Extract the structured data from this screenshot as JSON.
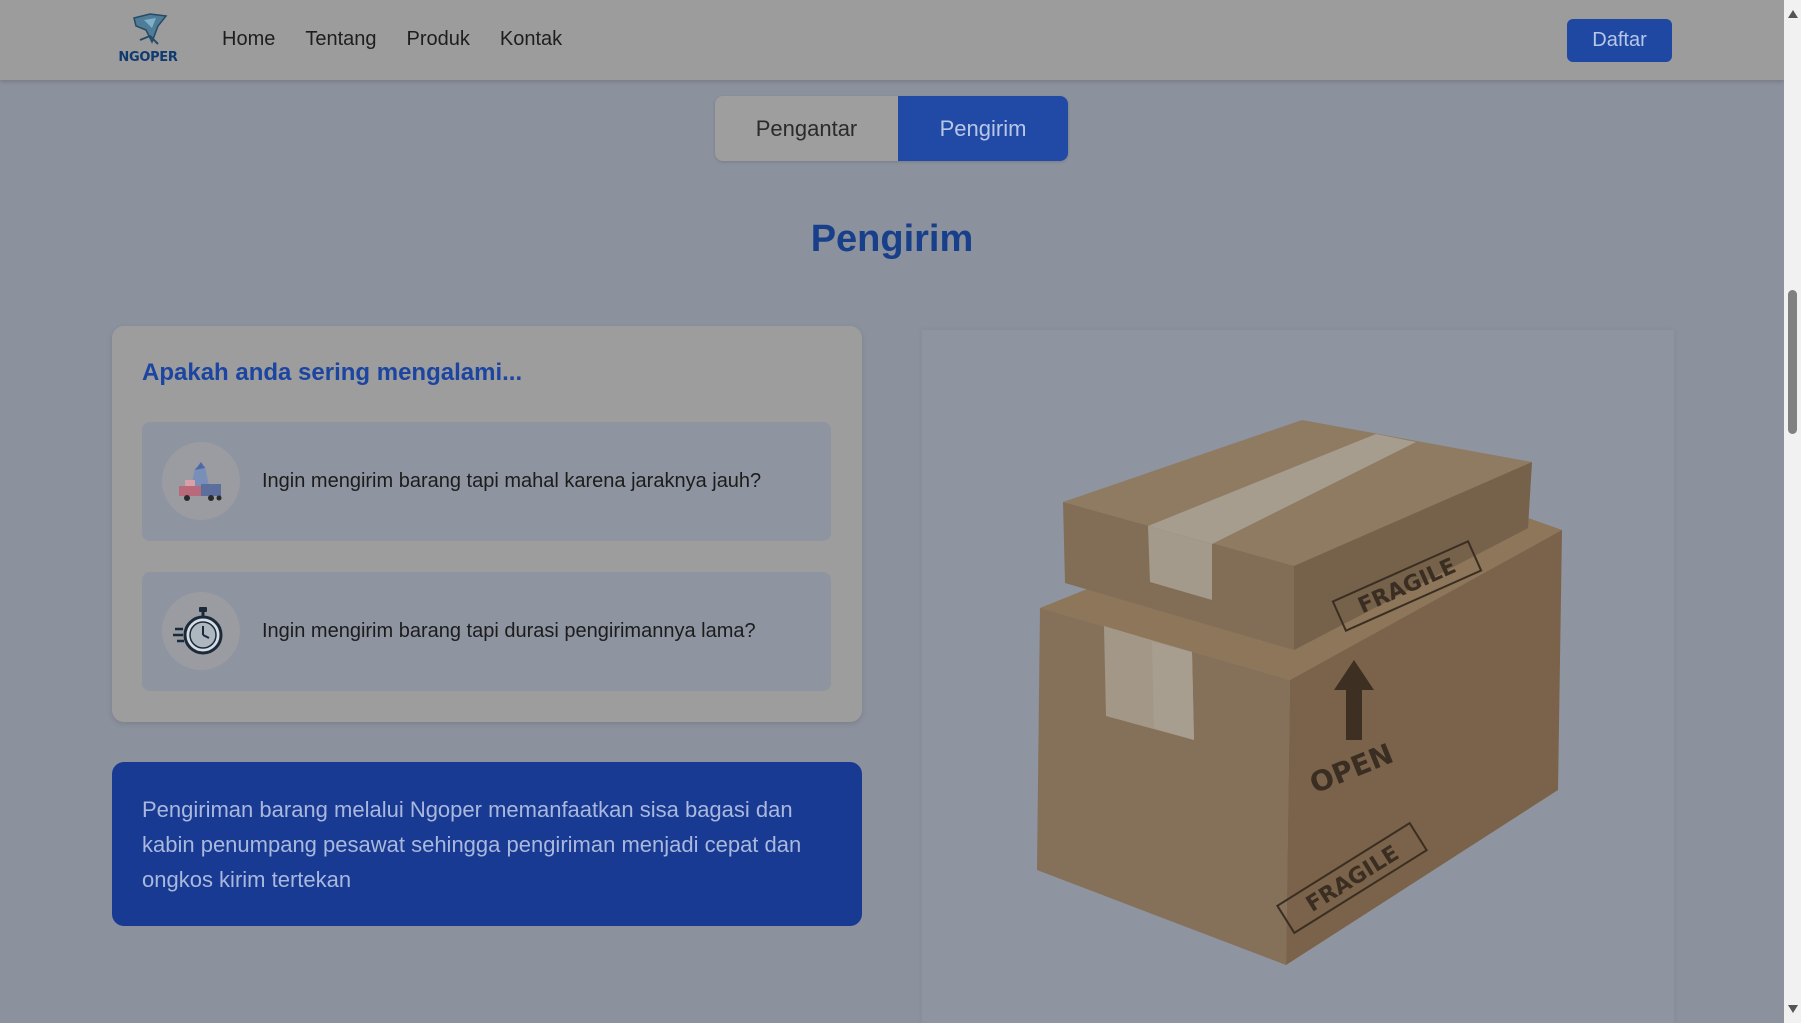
{
  "navbar": {
    "logo_text": "NGOPER",
    "links": [
      "Home",
      "Tentang",
      "Produk",
      "Kontak"
    ],
    "register_label": "Daftar"
  },
  "tabs": [
    {
      "label": "Pengantar",
      "active": false
    },
    {
      "label": "Pengirim",
      "active": true
    }
  ],
  "section": {
    "title": "Pengirim"
  },
  "problems": {
    "heading": "Apakah anda sering mengalami...",
    "items": [
      {
        "icon": "cargo-transport-icon",
        "text": "Ingin mengirim barang tapi mahal karena jaraknya jauh?"
      },
      {
        "icon": "stopwatch-icon",
        "text": "Ingin mengirim barang tapi durasi pengirimannya lama?"
      }
    ]
  },
  "info": {
    "text": "Pengiriman barang melalui Ngoper memanfaatkan sisa bagasi dan kabin penumpang pesawat sehingga pengiriman menjadi cepat dan ongkos kirim tertekan"
  },
  "illustration": {
    "label_top": "FRAGILE",
    "label_open": "OPEN",
    "label_bottom": "FRAGILE"
  },
  "colors": {
    "primary": "#1f48a3",
    "heading": "#183f8a",
    "overlay_bg": "#8c919e"
  }
}
